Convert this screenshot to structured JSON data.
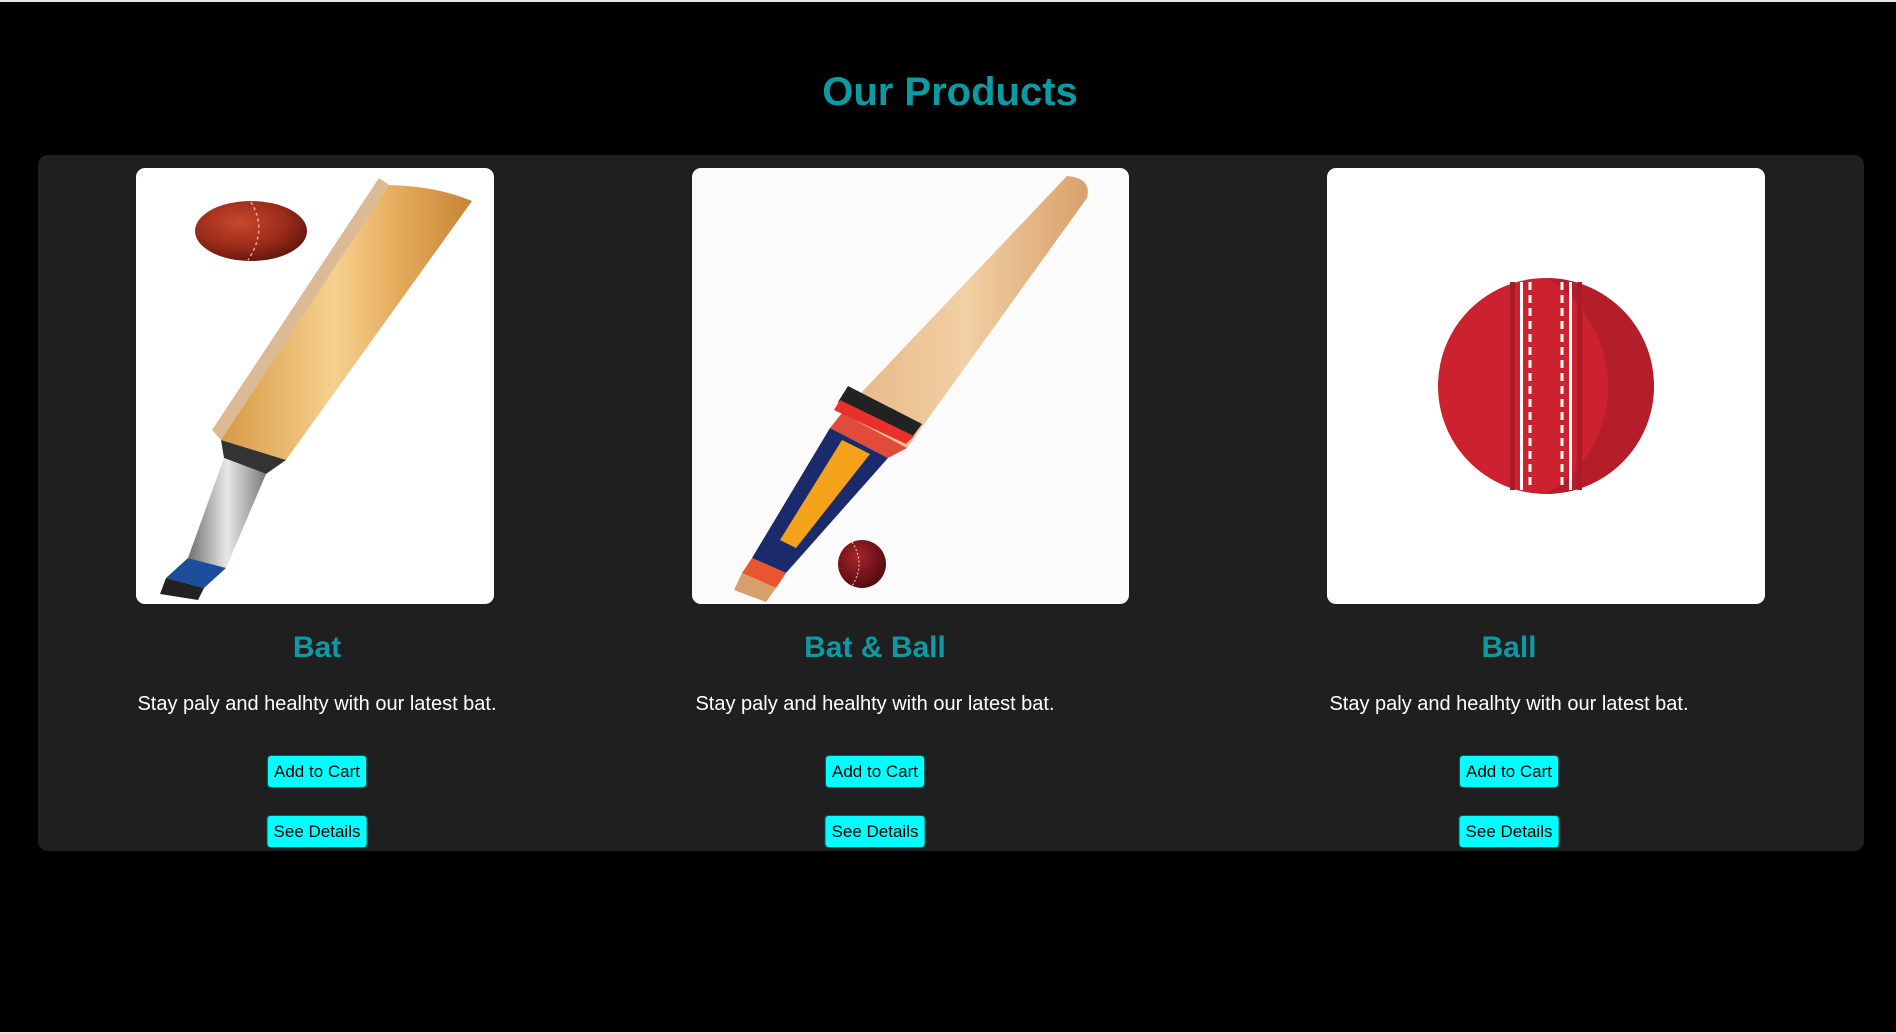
{
  "page": {
    "title": "Our Products",
    "accent_color": "#0c9aa4",
    "button_color": "#00ffff",
    "panel_color": "#1f1f1f",
    "background_color": "#000000"
  },
  "products": [
    {
      "name": "Bat",
      "description": "Stay paly and healhty with our latest bat.",
      "image": "cricket-bat-and-ball-image",
      "add_to_cart_label": "Add to Cart",
      "see_details_label": "See Details"
    },
    {
      "name": "Bat & Ball",
      "description": "Stay paly and healhty with our latest bat.",
      "image": "cricket-bat-with-small-ball-image",
      "add_to_cart_label": "Add to Cart",
      "see_details_label": "See Details"
    },
    {
      "name": "Ball",
      "description": "Stay paly and healhty with our latest bat.",
      "image": "cricket-ball-image",
      "add_to_cart_label": "Add to Cart",
      "see_details_label": "See Details"
    }
  ]
}
